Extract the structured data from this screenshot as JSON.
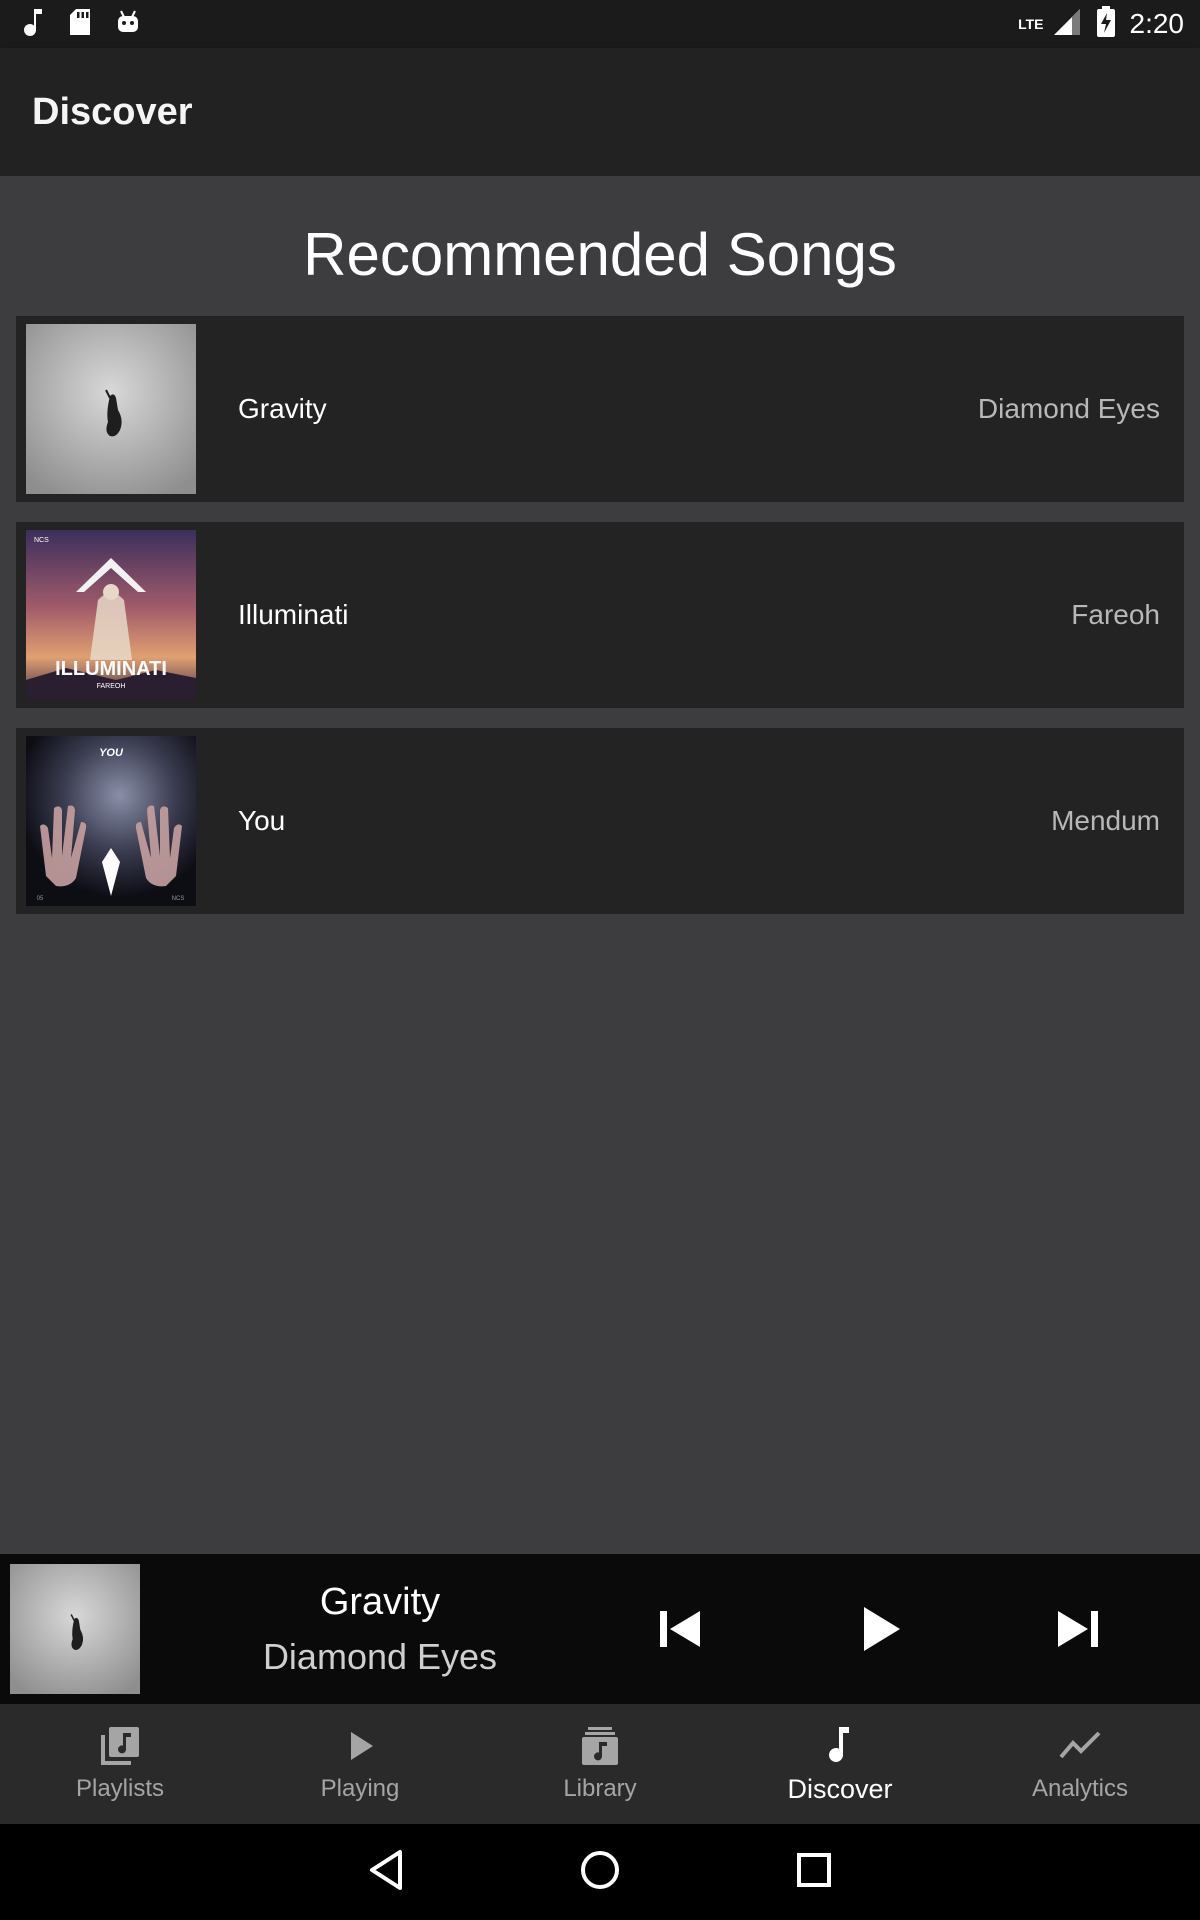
{
  "status_bar": {
    "time": "2:20",
    "network": "LTE",
    "left_icons": [
      "music-note-icon",
      "sd-card-icon",
      "android-icon"
    ],
    "right_icons": [
      "signal-icon",
      "battery-charging-icon"
    ]
  },
  "app_bar": {
    "title": "Discover"
  },
  "section": {
    "title": "Recommended Songs"
  },
  "songs": [
    {
      "title": "Gravity",
      "artist": "Diamond Eyes"
    },
    {
      "title": "Illuminati",
      "artist": "Fareoh"
    },
    {
      "title": "You",
      "artist": "Mendum"
    }
  ],
  "album_art_text": {
    "illuminati_title": "ILLUMINATI",
    "illuminati_artist": "FAREOH",
    "illuminati_badge": "NCS",
    "you_title": "YOU",
    "you_badge": "NCS",
    "you_number": "05"
  },
  "mini_player": {
    "title": "Gravity",
    "artist": "Diamond Eyes",
    "controls": [
      "skip-previous-icon",
      "play-icon",
      "skip-next-icon"
    ]
  },
  "bottom_nav": {
    "items": [
      {
        "label": "Playlists",
        "icon": "playlists-icon",
        "active": false
      },
      {
        "label": "Playing",
        "icon": "play-icon",
        "active": false
      },
      {
        "label": "Library",
        "icon": "library-icon",
        "active": false
      },
      {
        "label": "Discover",
        "icon": "music-note-icon",
        "active": true
      },
      {
        "label": "Analytics",
        "icon": "analytics-icon",
        "active": false
      }
    ]
  },
  "system_nav": [
    "back-icon",
    "home-icon",
    "recents-icon"
  ],
  "colors": {
    "background": "#3d3d40",
    "app_bar": "#222223",
    "row_background": "#232324",
    "mini_player": "#0a0a0a",
    "bottom_nav": "#2a2a2b",
    "inactive_label": "#a5a5a5",
    "artist_text": "#b8b8b8"
  }
}
